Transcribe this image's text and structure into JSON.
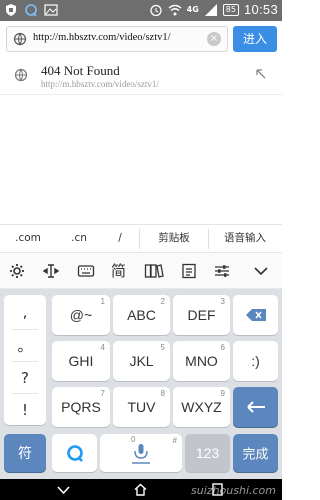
{
  "status_bar": {
    "time": "10:53",
    "battery": "85",
    "network": "4G",
    "icons": [
      "shield-icon",
      "qq-icon",
      "image-icon",
      "alarm-icon",
      "wifi-icon",
      "signal-icon",
      "battery-icon"
    ]
  },
  "browser": {
    "url_value": "http://m.hbsztv.com/video/sztv1/",
    "go_label": "进入"
  },
  "suggestion": {
    "title": "404 Not Found",
    "url": "http://m.hbsztv.com/video/sztv1/"
  },
  "quickbar": {
    "items": [
      ".com",
      ".cn",
      "/",
      "剪贴板",
      "语音输入"
    ]
  },
  "keyboard": {
    "toolbar_icons": [
      "settings-icon",
      "cursor-icon",
      "keyboard-icon",
      "simplified-icon",
      "books-icon",
      "clipboard-icon",
      "sliders-icon",
      "chevron-down-icon"
    ],
    "toolbar_text": "简",
    "side_symbols": [
      ",",
      "。",
      "?",
      "!"
    ],
    "rows": [
      [
        {
          "num": "1",
          "label": "@~"
        },
        {
          "num": "2",
          "label": "ABC"
        },
        {
          "num": "3",
          "label": "DEF"
        }
      ],
      [
        {
          "num": "4",
          "label": "GHI"
        },
        {
          "num": "5",
          "label": "JKL"
        },
        {
          "num": "6",
          "label": "MNO"
        }
      ],
      [
        {
          "num": "7",
          "label": "PQRS"
        },
        {
          "num": "8",
          "label": "TUV"
        },
        {
          "num": "9",
          "label": "WXYZ"
        }
      ]
    ],
    "emoji_key": ":)",
    "symbol_key": "符",
    "number_key": "123",
    "done_key": "完成",
    "space_num": "0",
    "space_hash": "#"
  },
  "watermark": "suizhoushi.com",
  "colors": {
    "accent": "#3a8ee6",
    "keyboard_blue": "#5b86be",
    "keyboard_bg": "#dcdfe3"
  }
}
